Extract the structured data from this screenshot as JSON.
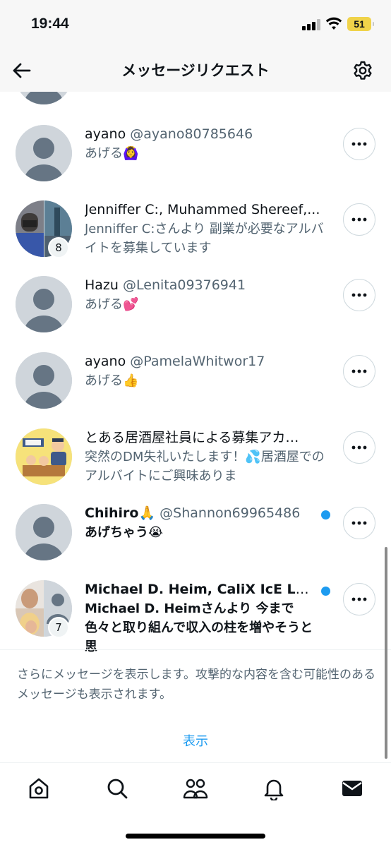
{
  "status_bar": {
    "time": "19:44",
    "battery": "51"
  },
  "header": {
    "title": "メッセージリクエスト"
  },
  "requests": [
    {
      "name": "ayano",
      "handle": "@ayano80785646",
      "preview": "あげる🙆‍♀️",
      "unread": false,
      "avatar": "default-avatar"
    },
    {
      "name": "Jenniffer C:, Muhammed Shereef,...",
      "handle": "",
      "preview": "Jenniffer C:さんより 副業が必要なアルバイトを募集しています",
      "unread": false,
      "avatar": "group-avatar",
      "member_count": "8"
    },
    {
      "name": "Hazu",
      "handle": "@Lenita09376941",
      "preview": "あげる💕",
      "unread": false,
      "avatar": "default-avatar"
    },
    {
      "name": "ayano",
      "handle": "@PamelaWhitwor17",
      "preview": "あげる👍",
      "unread": false,
      "avatar": "default-avatar"
    },
    {
      "name": "とある居酒屋社員による募集アカ…",
      "handle": "",
      "preview": "突然のDM失礼いたします！💦居酒屋でのアルバイトにご興味ありま",
      "unread": false,
      "avatar": "izakaya-avatar"
    },
    {
      "name": "Chihiro🙏",
      "handle": "@Shannon69965486",
      "preview": "あげちゃう😭",
      "unread": true,
      "avatar": "default-avatar"
    },
    {
      "name": "Michael D. Heim, CaliX IcE La...",
      "handle": "",
      "preview": "Michael D. Heimさんより 今まで色々と取り組んで収入の柱を増やそうと思",
      "unread": true,
      "avatar": "group-avatar",
      "member_count": "7"
    }
  ],
  "notice": "さらにメッセージを表示します。攻撃的な内容を含む可能性のあるメッセージも表示されます。",
  "show_link": "表示",
  "tabs": [
    "home-icon",
    "search-icon",
    "communities-icon",
    "notifications-icon",
    "messages-icon"
  ],
  "colors": {
    "accent": "#1d9bf0",
    "secondary_text": "#536471",
    "border": "#cfd9de"
  }
}
